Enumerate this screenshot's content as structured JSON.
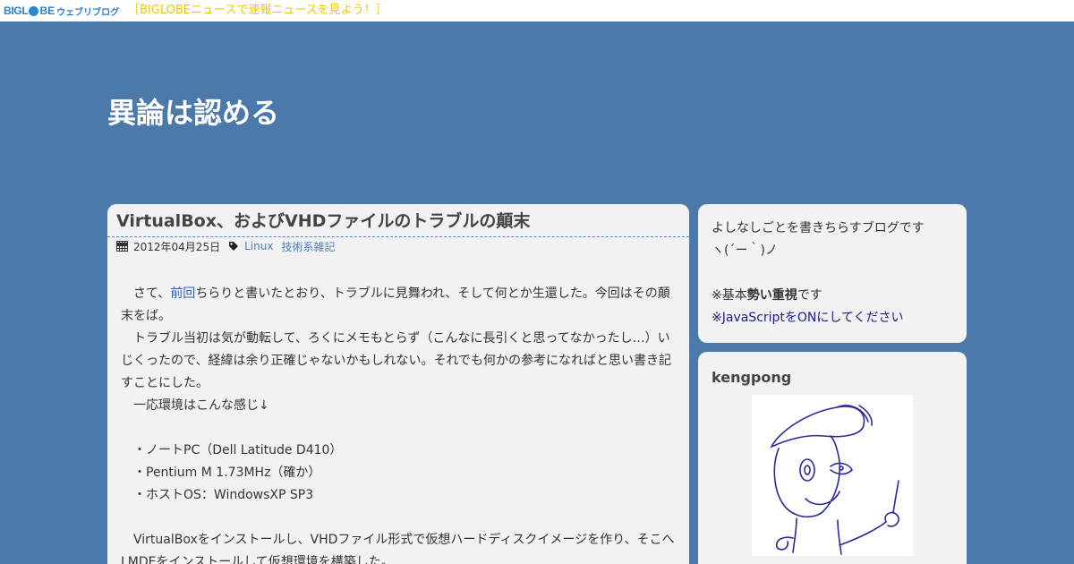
{
  "topbar": {
    "logo_big": "BIGL",
    "logo_be": "BE",
    "logo_sub": "ウェブリブログ",
    "news_link": "［BIGLOBEニュースで速報ニュースを見よう！］"
  },
  "blog": {
    "title": "異論は認める"
  },
  "post": {
    "title": "VirtualBox、およびVHDファイルのトラブルの顛末",
    "date": "2012年04月25日",
    "categories": [
      "Linux",
      "技術系雑記"
    ],
    "body": {
      "p1_before": "　さて、",
      "p1_link": "前回",
      "p1_after": "ちらりと書いたとおり、トラブルに見舞われ、そして何とか生還した。今回はその顛末をば。",
      "p2": "　トラブル当初は気が動転して、ろくにメモもとらず（こんなに長引くと思ってなかったし…）いじくったので、経緯は余り正確じゃないかもしれない。それでも何かの参考になればと思い書き記すことにした。",
      "p3": "　一応環境はこんな感じ↓",
      "spec1": "　・ノートPC（Dell Latitude D410）",
      "spec2": "　・Pentium M 1.73MHz（確か）",
      "spec3": "　・ホストOS：WindowsXP SP3",
      "p4": "　VirtualBoxをインストールし、VHDファイル形式で仮想ハードディスクイメージを作り、そこへLMDEをインストールして仮想環境を構築した。"
    }
  },
  "sidebar": {
    "about": {
      "line1": "よしなしごとを書きちらすブログです",
      "line2": "ヽ(´ー｀)ノ",
      "note_prefix": "※基本",
      "note_bold": "勢い重視",
      "note_suffix": "です",
      "js_notice": "※JavaScriptをONにしてください"
    },
    "profile": {
      "name": "kengpong"
    }
  },
  "colors": {
    "background": "#4b7aaa",
    "panel": "#f2f2f2",
    "link": "#4a7db8",
    "topnews": "#f0c800"
  }
}
